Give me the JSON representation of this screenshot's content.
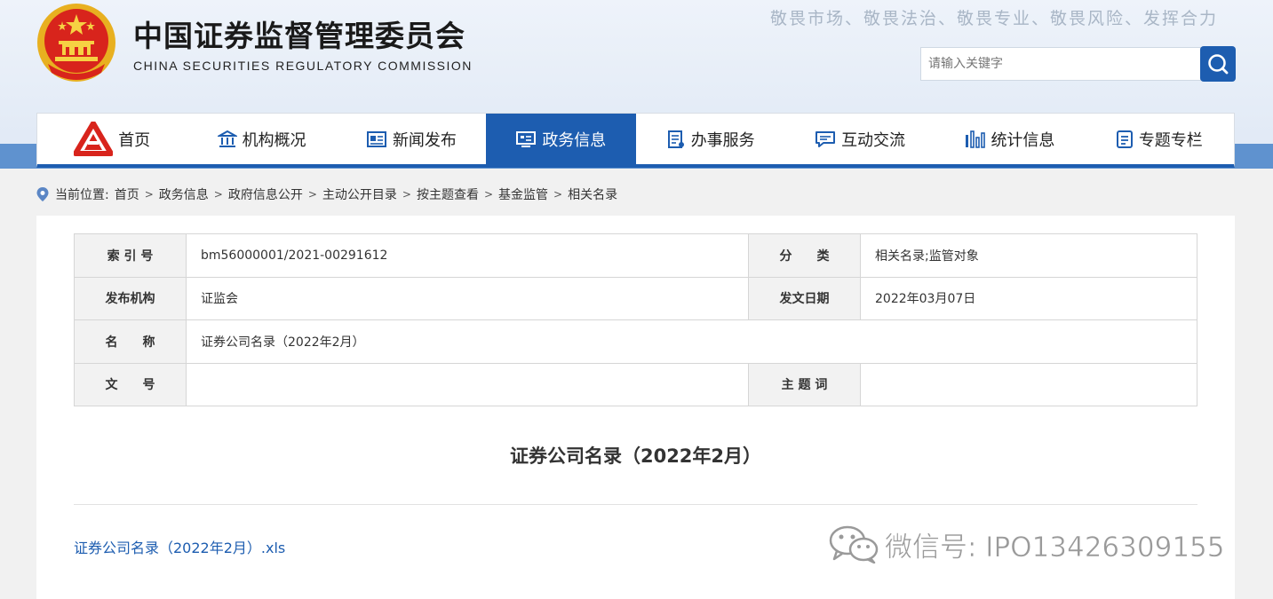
{
  "header": {
    "title": "中国证券监督管理委员会",
    "subtitle": "CHINA SECURITIES REGULATORY COMMISSION",
    "slogan": "敬畏市场、敬畏法治、敬畏专业、敬畏风险、发挥合力",
    "search_placeholder": "请输入关键字"
  },
  "nav": {
    "items": [
      {
        "label": "首页",
        "icon": "csrc-logo-icon"
      },
      {
        "label": "机构概况",
        "icon": "building-icon"
      },
      {
        "label": "新闻发布",
        "icon": "newspaper-icon"
      },
      {
        "label": "政务信息",
        "icon": "monitor-icon",
        "active": true
      },
      {
        "label": "办事服务",
        "icon": "service-icon"
      },
      {
        "label": "互动交流",
        "icon": "chat-icon"
      },
      {
        "label": "统计信息",
        "icon": "bar-chart-icon"
      },
      {
        "label": "专题专栏",
        "icon": "document-icon"
      }
    ],
    "active_color": "#1d5db0"
  },
  "breadcrumb": {
    "prefix": "当前位置:",
    "items": [
      "首页",
      "政务信息",
      "政府信息公开",
      "主动公开目录",
      "按主题查看",
      "基金监管",
      "相关名录"
    ]
  },
  "meta": {
    "index_label": "索 引 号",
    "index_value": "bm56000001/2021-00291612",
    "category_label": "分　　类",
    "category_value": "相关名录;监管对象",
    "publisher_label": "发布机构",
    "publisher_value": "证监会",
    "date_label": "发文日期",
    "date_value": "2022年03月07日",
    "name_label": "名　　称",
    "name_value": "证券公司名录（2022年2月）",
    "docno_label": "文　　号",
    "docno_value": "",
    "subject_label": "主 题 词",
    "subject_value": ""
  },
  "document": {
    "title": "证券公司名录（2022年2月）",
    "attachment": "证券公司名录（2022年2月）.xls"
  },
  "watermark": {
    "text": "微信号: IPO13426309155"
  }
}
